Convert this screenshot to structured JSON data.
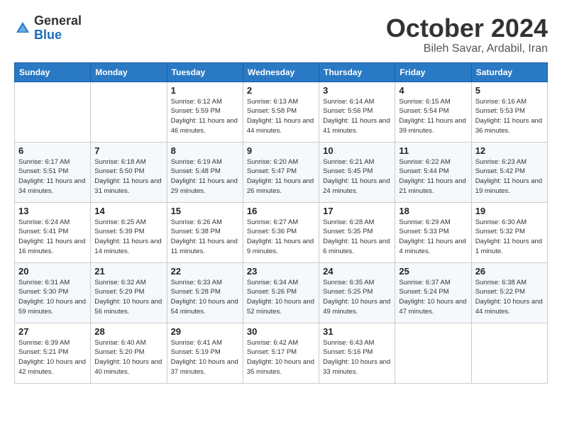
{
  "header": {
    "logo_general": "General",
    "logo_blue": "Blue",
    "month_title": "October 2024",
    "location": "Bileh Savar, Ardabil, Iran"
  },
  "days_of_week": [
    "Sunday",
    "Monday",
    "Tuesday",
    "Wednesday",
    "Thursday",
    "Friday",
    "Saturday"
  ],
  "weeks": [
    [
      {
        "day": null,
        "data": null
      },
      {
        "day": null,
        "data": null
      },
      {
        "day": "1",
        "data": "Sunrise: 6:12 AM\nSunset: 5:59 PM\nDaylight: 11 hours and 46 minutes."
      },
      {
        "day": "2",
        "data": "Sunrise: 6:13 AM\nSunset: 5:58 PM\nDaylight: 11 hours and 44 minutes."
      },
      {
        "day": "3",
        "data": "Sunrise: 6:14 AM\nSunset: 5:56 PM\nDaylight: 11 hours and 41 minutes."
      },
      {
        "day": "4",
        "data": "Sunrise: 6:15 AM\nSunset: 5:54 PM\nDaylight: 11 hours and 39 minutes."
      },
      {
        "day": "5",
        "data": "Sunrise: 6:16 AM\nSunset: 5:53 PM\nDaylight: 11 hours and 36 minutes."
      }
    ],
    [
      {
        "day": "6",
        "data": "Sunrise: 6:17 AM\nSunset: 5:51 PM\nDaylight: 11 hours and 34 minutes."
      },
      {
        "day": "7",
        "data": "Sunrise: 6:18 AM\nSunset: 5:50 PM\nDaylight: 11 hours and 31 minutes."
      },
      {
        "day": "8",
        "data": "Sunrise: 6:19 AM\nSunset: 5:48 PM\nDaylight: 11 hours and 29 minutes."
      },
      {
        "day": "9",
        "data": "Sunrise: 6:20 AM\nSunset: 5:47 PM\nDaylight: 11 hours and 26 minutes."
      },
      {
        "day": "10",
        "data": "Sunrise: 6:21 AM\nSunset: 5:45 PM\nDaylight: 11 hours and 24 minutes."
      },
      {
        "day": "11",
        "data": "Sunrise: 6:22 AM\nSunset: 5:44 PM\nDaylight: 11 hours and 21 minutes."
      },
      {
        "day": "12",
        "data": "Sunrise: 6:23 AM\nSunset: 5:42 PM\nDaylight: 11 hours and 19 minutes."
      }
    ],
    [
      {
        "day": "13",
        "data": "Sunrise: 6:24 AM\nSunset: 5:41 PM\nDaylight: 11 hours and 16 minutes."
      },
      {
        "day": "14",
        "data": "Sunrise: 6:25 AM\nSunset: 5:39 PM\nDaylight: 11 hours and 14 minutes."
      },
      {
        "day": "15",
        "data": "Sunrise: 6:26 AM\nSunset: 5:38 PM\nDaylight: 11 hours and 11 minutes."
      },
      {
        "day": "16",
        "data": "Sunrise: 6:27 AM\nSunset: 5:36 PM\nDaylight: 11 hours and 9 minutes."
      },
      {
        "day": "17",
        "data": "Sunrise: 6:28 AM\nSunset: 5:35 PM\nDaylight: 11 hours and 6 minutes."
      },
      {
        "day": "18",
        "data": "Sunrise: 6:29 AM\nSunset: 5:33 PM\nDaylight: 11 hours and 4 minutes."
      },
      {
        "day": "19",
        "data": "Sunrise: 6:30 AM\nSunset: 5:32 PM\nDaylight: 11 hours and 1 minute."
      }
    ],
    [
      {
        "day": "20",
        "data": "Sunrise: 6:31 AM\nSunset: 5:30 PM\nDaylight: 10 hours and 59 minutes."
      },
      {
        "day": "21",
        "data": "Sunrise: 6:32 AM\nSunset: 5:29 PM\nDaylight: 10 hours and 56 minutes."
      },
      {
        "day": "22",
        "data": "Sunrise: 6:33 AM\nSunset: 5:28 PM\nDaylight: 10 hours and 54 minutes."
      },
      {
        "day": "23",
        "data": "Sunrise: 6:34 AM\nSunset: 5:26 PM\nDaylight: 10 hours and 52 minutes."
      },
      {
        "day": "24",
        "data": "Sunrise: 6:35 AM\nSunset: 5:25 PM\nDaylight: 10 hours and 49 minutes."
      },
      {
        "day": "25",
        "data": "Sunrise: 6:37 AM\nSunset: 5:24 PM\nDaylight: 10 hours and 47 minutes."
      },
      {
        "day": "26",
        "data": "Sunrise: 6:38 AM\nSunset: 5:22 PM\nDaylight: 10 hours and 44 minutes."
      }
    ],
    [
      {
        "day": "27",
        "data": "Sunrise: 6:39 AM\nSunset: 5:21 PM\nDaylight: 10 hours and 42 minutes."
      },
      {
        "day": "28",
        "data": "Sunrise: 6:40 AM\nSunset: 5:20 PM\nDaylight: 10 hours and 40 minutes."
      },
      {
        "day": "29",
        "data": "Sunrise: 6:41 AM\nSunset: 5:19 PM\nDaylight: 10 hours and 37 minutes."
      },
      {
        "day": "30",
        "data": "Sunrise: 6:42 AM\nSunset: 5:17 PM\nDaylight: 10 hours and 35 minutes."
      },
      {
        "day": "31",
        "data": "Sunrise: 6:43 AM\nSunset: 5:16 PM\nDaylight: 10 hours and 33 minutes."
      },
      {
        "day": null,
        "data": null
      },
      {
        "day": null,
        "data": null
      }
    ]
  ]
}
